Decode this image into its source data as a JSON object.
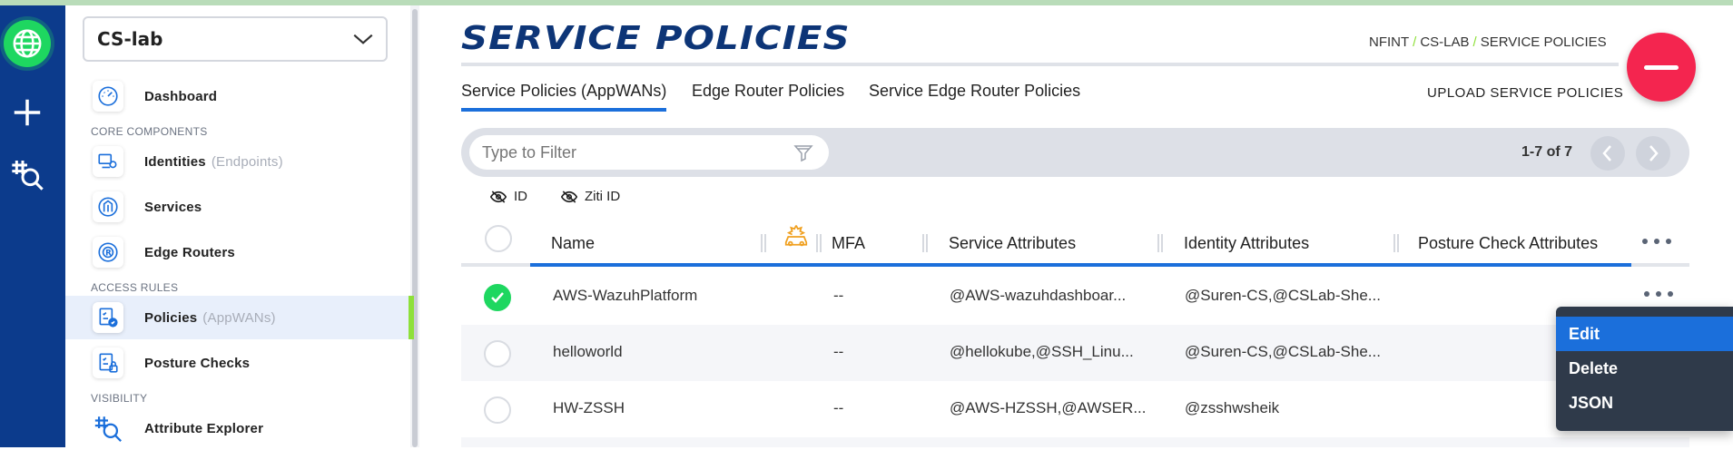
{
  "network": {
    "selected": "CS-lab"
  },
  "sidebar": {
    "dashboard": "Dashboard",
    "section_core": "CORE COMPONENTS",
    "identities": "Identities",
    "identities_sub": "(Endpoints)",
    "services": "Services",
    "edge_routers": "Edge Routers",
    "section_access": "ACCESS RULES",
    "policies": "Policies",
    "policies_sub": "(AppWANs)",
    "posture_checks": "Posture Checks",
    "section_visibility": "VISIBILITY",
    "attribute_explorer": "Attribute Explorer"
  },
  "header": {
    "title": "SERVICE POLICIES",
    "breadcrumb": [
      "NFINT",
      "CS-LAB",
      "SERVICE POLICIES"
    ],
    "upload": "UPLOAD SERVICE POLICIES"
  },
  "tabs": [
    {
      "label": "Service Policies (AppWANs)",
      "active": true
    },
    {
      "label": "Edge Router Policies",
      "active": false
    },
    {
      "label": "Service Edge Router Policies",
      "active": false
    }
  ],
  "filter": {
    "placeholder": "Type to Filter",
    "value": ""
  },
  "pager": {
    "text": "1-7 of 7"
  },
  "toggles": {
    "id": "ID",
    "ziti_id": "Ziti ID"
  },
  "columns": {
    "name": "Name",
    "mfa": "MFA",
    "service_attributes": "Service Attributes",
    "identity_attributes": "Identity Attributes",
    "posture_check_attributes": "Posture Check Attributes"
  },
  "rows": [
    {
      "name": "AWS-WazuhPlatform",
      "mfa": "--",
      "service_attributes": "@AWS-wazuhdashboar...",
      "identity_attributes": "@Suren-CS,@CSLab-She...",
      "selected": true
    },
    {
      "name": "helloworld",
      "mfa": "--",
      "service_attributes": "@hellokube,@SSH_Linu...",
      "identity_attributes": "@Suren-CS,@CSLab-She...",
      "selected": false
    },
    {
      "name": "HW-ZSSH",
      "mfa": "--",
      "service_attributes": "@AWS-HZSSH,@AWSER...",
      "identity_attributes": "@zsshwsheik",
      "selected": false
    }
  ],
  "context_menu": {
    "edit": "Edit",
    "delete": "Delete",
    "json": "JSON"
  },
  "colors": {
    "navy": "#0c3b8c",
    "accent_blue": "#1b6fdb",
    "green": "#1ed760",
    "fab_red": "#f4254f",
    "lime": "#8ee03a"
  }
}
